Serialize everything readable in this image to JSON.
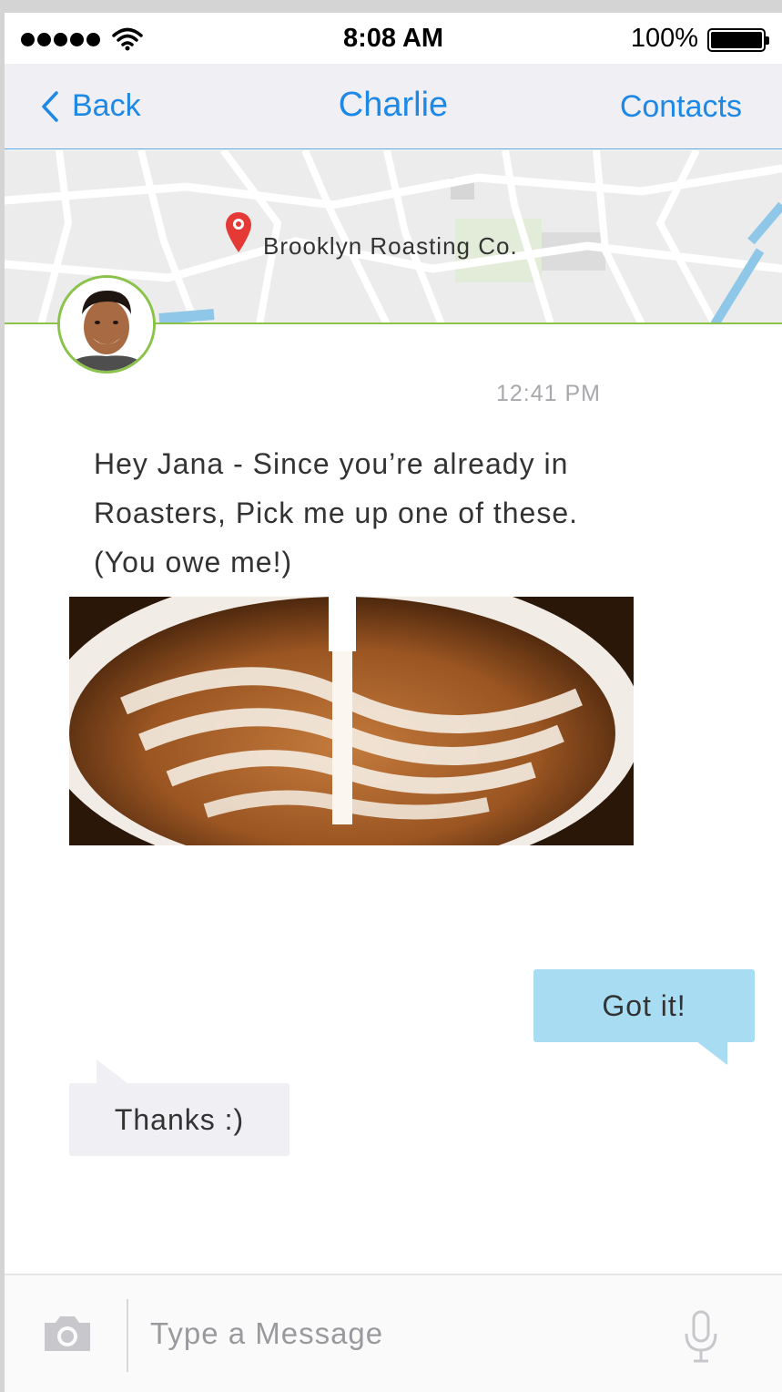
{
  "status": {
    "time": "8:08 AM",
    "battery": "100%"
  },
  "nav": {
    "back": "Back",
    "title": "Charlie",
    "contacts": "Contacts"
  },
  "map": {
    "place": "Brooklyn Roasting Co."
  },
  "chat": {
    "timestamp": "12:41 PM",
    "message": "Hey Jana - Since you’re already in Roasters, Pick me up one of these. (You owe me!)",
    "outgoing": "Got it!",
    "incoming": "Thanks :)"
  },
  "composer": {
    "placeholder": "Type a Message"
  },
  "colors": {
    "accent": "#1e88e5",
    "outgoing_bubble": "#a8dcf2",
    "incoming_bubble": "#efeff4",
    "avatar_ring": "#8bc34a",
    "pin": "#e53935"
  }
}
